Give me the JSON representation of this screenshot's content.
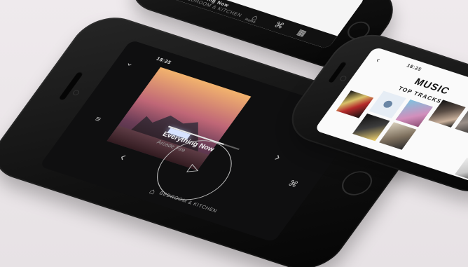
{
  "left_phone": {
    "status": {
      "time": "18:25"
    },
    "track": {
      "title": "Everything Now",
      "artist": "Arcade Fire"
    },
    "room": {
      "label": "BEDROOM & KITCHEN"
    },
    "icons": {
      "back": "chevron-down-icon",
      "menu": "more-icon",
      "queue": "list-icon",
      "prev": "chevron-left-icon",
      "next": "chevron-right-icon",
      "play": "play-icon",
      "speaker": "speaker-icon",
      "output": "cast-icon"
    },
    "progress": 0.78
  },
  "right_phone": {
    "status": {
      "time": "18:25"
    },
    "header": {
      "title": "MUSIC",
      "section": "TOP TRACKS",
      "partial_label": "TO"
    },
    "icons": {
      "search": "search-icon",
      "menu": "more-icon",
      "back": "back-icon"
    }
  },
  "top_phone": {
    "track": {
      "title": "Everything Now",
      "subtitle": "BEDROOM & KITCHEN"
    },
    "nav": {
      "home": "Home"
    },
    "icons": {
      "play": "play-icon",
      "home": "home-icon",
      "cast": "cast-icon",
      "grid": "grid-icon"
    }
  },
  "colors": {
    "background": "#ece8ea",
    "phone": "#111111",
    "accent": "#e6e6e6"
  }
}
